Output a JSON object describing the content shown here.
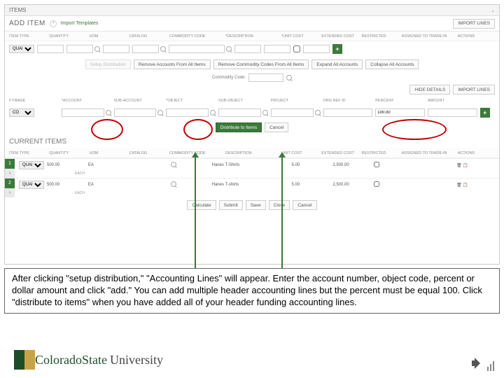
{
  "sections": {
    "items": "ITEMS",
    "addItem": "ADD ITEM",
    "currentItems": "CURRENT ITEMS"
  },
  "links": {
    "importTemplates": "Import Templates"
  },
  "buttons": {
    "importLines": "IMPORT LINES",
    "setupDistribution": "Setup Distribution",
    "removeAccounts": "Remove Accounts From All Items",
    "removeCommodity": "Remove Commodity Codes From All Items",
    "expandAll": "Expand All Accounts",
    "collapseAll": "Collapse All Accounts",
    "hideDetails": "HIDE DETAILS",
    "distribute": "Distribute to Items",
    "cancel": "Cancel",
    "calculate": "Calculate",
    "submit": "Submit",
    "save": "Save",
    "close": "Close",
    "commodityCode": "Commodity Code:"
  },
  "headers1": [
    "ITEM TYPE",
    "QUANTITY",
    "UOM",
    "CATALOG",
    "COMMODITY CODE",
    "*DESCRIPTION",
    "*UNIT COST",
    "EXTENDED COST",
    "RESTRICTED",
    "ASSIGNED TO TRADE-IN",
    "ACTIONS"
  ],
  "headers2": [
    "FY/BASE",
    "*ACCOUNT",
    "SUB-ACCOUNT",
    "*OBJECT",
    "SUB-OBJECT",
    "PROJECT",
    "ORG REF ID",
    "PERCENT",
    "AMOUNT"
  ],
  "addItemRow": {
    "type": "QUANTITY",
    "qty": ""
  },
  "acctRow": {
    "fybase": "CO",
    "percent": "100.00"
  },
  "currentHeaders": [
    "ITEM TYPE",
    "QUANTITY",
    "UOM",
    "CATALOG",
    "COMMODITY CODE",
    "DESCRIPTION",
    "UNIT COST",
    "EXTENDED COST",
    "RESTRICTED",
    "ASSIGNED TO TRADE-IN",
    "ACTIONS"
  ],
  "currentItems": [
    {
      "num": "1",
      "type": "QUANTITY",
      "qty": "500.00",
      "uom": "EA",
      "uomSub": "EACH",
      "desc": "Hanes T-Shirts",
      "unit": "5.00",
      "ext": "2,500.00"
    },
    {
      "num": "2",
      "type": "QUANTITY",
      "qty": "500.00",
      "uom": "EA",
      "uomSub": "EACH",
      "desc": "Hanes T-shirts",
      "unit": "5.00",
      "ext": "2,500.00"
    }
  ],
  "caption": "After clicking \"setup distribution,\" \"Accounting Lines\" will appear. Enter the account number, object code, percent or dollar amount and click \"add.\" You can add multiple header accounting lines but the percent must be equal 100. Click \"distribute to items\" when you have added all of your header funding accounting lines.",
  "logo": {
    "t1": "ColoradoState",
    "t2": "University"
  }
}
